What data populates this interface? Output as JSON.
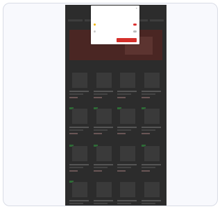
{
  "colors": {
    "card_bg": "#f8f9fd",
    "overlay": "#2c2c2c",
    "accent": "#d4302b",
    "badge_green": "#2e6b36"
  },
  "site": {
    "logo": "",
    "section_title": ""
  },
  "cookie_modal": {
    "title": "",
    "close_icon": "close-icon",
    "description": "",
    "options": [
      {
        "label": ""
      },
      {
        "label": ""
      }
    ],
    "secondary_button": "",
    "primary_button": ""
  },
  "products": {
    "rows": 4,
    "per_row": 4
  }
}
